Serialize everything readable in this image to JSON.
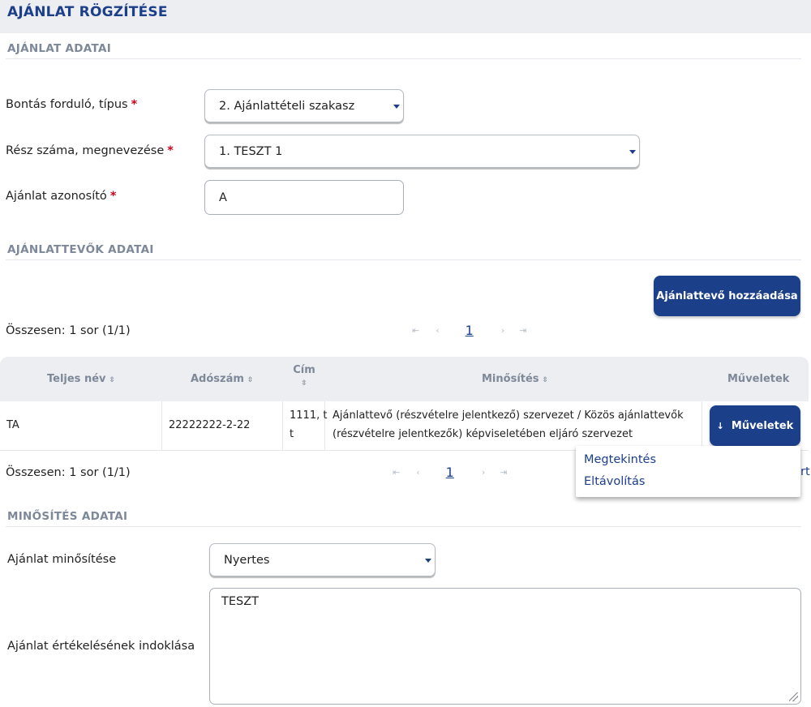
{
  "page": {
    "title": "AJÁNLAT RÖGZÍTÉSE"
  },
  "offer_section": {
    "title": "AJÁNLAT ADATAI",
    "round_label": "Bontás forduló, típus",
    "round_value": "2. Ajánlattételi szakasz",
    "part_label": "Rész száma, megnevezése",
    "part_value": "1. TESZT 1",
    "id_label": "Ajánlat azonosító",
    "id_value": "A",
    "required_mark": "*"
  },
  "bidders_section": {
    "title": "AJÁNLATTEVŐK ADATAI",
    "add_button": "Ajánlattevő hozzáadása",
    "summary": "Összesen: 1 sor (1/1)",
    "page_number": "1",
    "pager_icons": {
      "first": "⇤",
      "prev": "‹",
      "next": "›",
      "last": "⇥"
    },
    "columns": {
      "name": "Teljes név",
      "tax": "Adószám",
      "address": "Cím",
      "qualification": "Minősítés",
      "actions": "Műveletek"
    },
    "sort_icon": "⇳",
    "rows": [
      {
        "name": "TA",
        "tax": "22222222-2-22",
        "address_line1": "1111, t",
        "address_line2": "t",
        "qualification_line1": "Ajánlattevő (részvételre jelentkező) szervezet / Közös ajánlattevők",
        "qualification_line2": "(részvételre jelentkezők) képviseletében eljáró szervezet",
        "actions_button": "Műveletek"
      }
    ],
    "menu": {
      "view": "Megtekintés",
      "remove": "Eltávolítás"
    },
    "hidden_fragment": "rt"
  },
  "rating_section": {
    "title": "MINŐSÍTÉS ADATAI",
    "rating_label": "Ajánlat minősítése",
    "rating_value": "Nyertes",
    "reason_label": "Ajánlat értékelésének indoklása",
    "reason_value": "TESZT"
  },
  "colors": {
    "accent": "#1c3f8a",
    "required": "#d0001b",
    "muted": "#7d8899"
  }
}
